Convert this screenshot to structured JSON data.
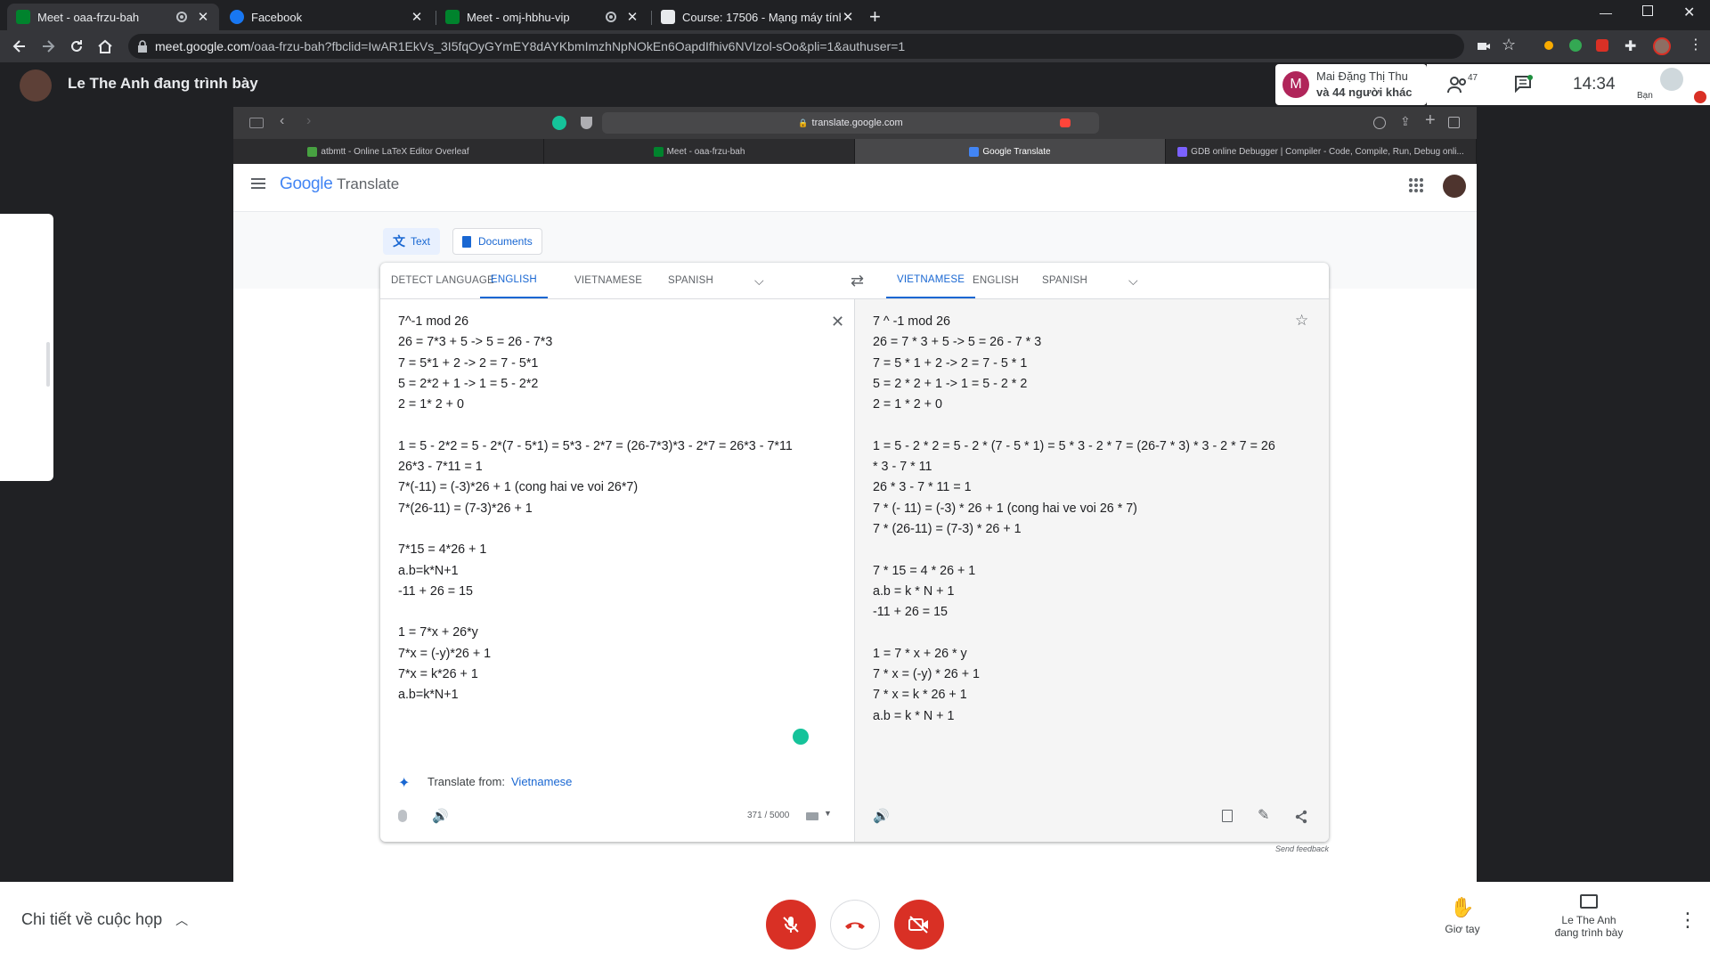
{
  "chrome_tabs": [
    {
      "title": "Meet - oaa-frzu-bah",
      "recording": true,
      "active": true
    },
    {
      "title": "Facebook",
      "recording": false,
      "active": false
    },
    {
      "title": "Meet - omj-hbhu-vip",
      "recording": true,
      "active": false
    },
    {
      "title": "Course: 17506 - Mạng máy tính",
      "recording": false,
      "active": false
    }
  ],
  "address_bar": {
    "host": "meet.google.com",
    "path": "/oaa-frzu-bah?fbclid=IwAR1EkVs_3I5fqOyGYmEY8dAYKbmImzhNpNOkEn6OapdIfhiv6NVIzol-sOo&pli=1&authuser=1"
  },
  "meet": {
    "presenter_banner": "Le The Anh đang trình bày",
    "speaker": {
      "avatar_letter": "M",
      "name": "Mai Đặng Thị Thu",
      "others": "và 44 người khác"
    },
    "participant_count": "47",
    "time": "14:34",
    "self_label": "Bạn",
    "meeting_details": "Chi tiết về cuộc họp",
    "raise_hand": "Giơ tay",
    "presenter_line1": "Le The Anh",
    "presenter_line2": "đang trình bày"
  },
  "shared_browser": {
    "url": "translate.google.com",
    "tabs": [
      {
        "title": "atbmtt - Online LaTeX Editor Overleaf",
        "color": "#47a141"
      },
      {
        "title": "Meet - oaa-frzu-bah",
        "color": "#00832d"
      },
      {
        "title": "Google Translate",
        "color": "#4285f4"
      },
      {
        "title": "GDB online Debugger | Compiler - Code, Compile, Run, Debug onli...",
        "color": "#7b61ff"
      }
    ]
  },
  "translate": {
    "logo": "Google",
    "product": "Translate",
    "modes": {
      "text": "Text",
      "documents": "Documents"
    },
    "source_langs": [
      "DETECT LANGUAGE",
      "ENGLISH",
      "VIETNAMESE",
      "SPANISH"
    ],
    "target_langs": [
      "VIETNAMESE",
      "ENGLISH",
      "SPANISH"
    ],
    "source_text": "7^-1 mod 26\n26 = 7*3 + 5 -> 5 = 26 - 7*3\n7 = 5*1 + 2 -> 2 = 7 - 5*1\n5 = 2*2 + 1 -> 1 = 5 - 2*2\n2 = 1* 2 + 0\n\n1 = 5 - 2*2 = 5 - 2*(7 - 5*1) = 5*3 - 2*7 = (26-7*3)*3 - 2*7 = 26*3 - 7*11\n26*3 - 7*11 = 1\n7*(-11) = (-3)*26 + 1 (cong hai ve voi 26*7)\n7*(26-11) = (7-3)*26 + 1\n\n7*15 = 4*26 + 1\na.b=k*N+1\n-11 + 26 = 15\n\n1 = 7*x + 26*y\n7*x = (-y)*26 + 1\n7*x = k*26 + 1\na.b=k*N+1",
    "target_text": "7 ^ -1 mod 26\n26 = 7 * 3 + 5 -> 5 = 26 - 7 * 3\n7 = 5 * 1 + 2 -> 2 = 7 - 5 * 1\n5 = 2 * 2 + 1 -> 1 = 5 - 2 * 2\n2 = 1 * 2 + 0\n\n1 = 5 - 2 * 2 = 5 - 2 * (7 - 5 * 1) = 5 * 3 - 2 * 7 = (26-7 * 3) * 3 - 2 * 7 = 26\n* 3 - 7 * 11\n26 * 3 - 7 * 11 = 1\n7 * (- 11) = (-3) * 26 + 1 (cong hai ve voi 26 * 7)\n7 * (26-11) = (7-3) * 26 + 1\n\n7 * 15 = 4 * 26 + 1\na.b = k * N + 1\n-11 + 26 = 15\n\n1 = 7 * x + 26 * y\n7 * x = (-y) * 26 + 1\n7 * x = k * 26 + 1\na.b = k * N + 1",
    "translate_from_label": "Translate from:",
    "translate_from_lang": "Vietnamese",
    "char_count": "371 / 5000",
    "send_feedback": "Send feedback"
  },
  "colors": {
    "accent": "#1967d2",
    "danger": "#d93025",
    "chrome_dark": "#202124"
  }
}
